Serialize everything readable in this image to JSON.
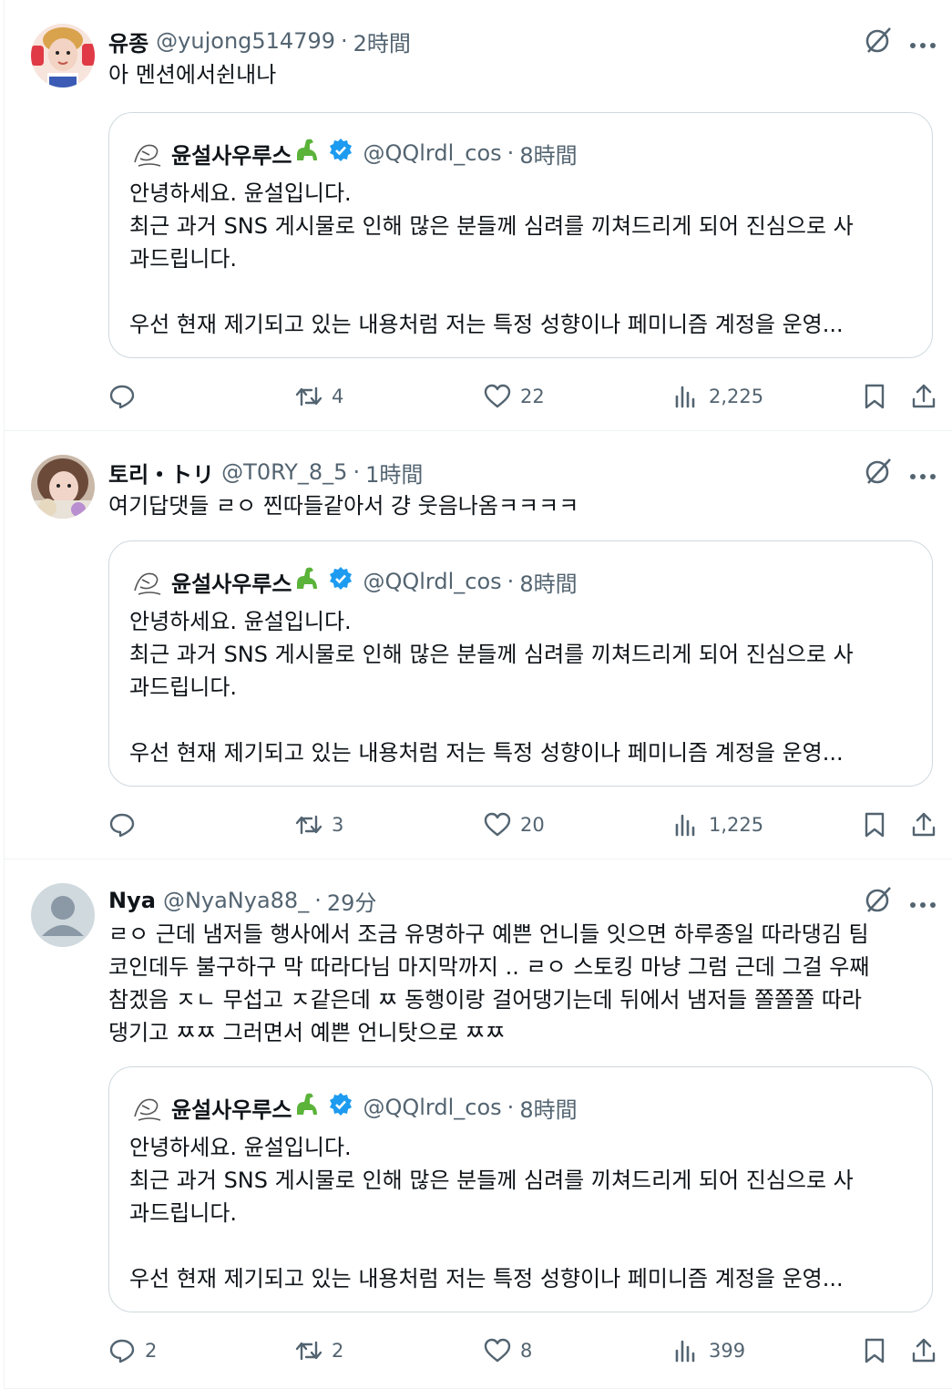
{
  "posts": [
    {
      "author": "유종",
      "handle": "@yujong514799",
      "separator": "·",
      "time": "2時間",
      "text": "아 멘션에서쉰내나",
      "avatar_icon": "profile-photo",
      "quote": {
        "author": "윤설사우루스",
        "handle": "@QQlrdl_cos",
        "separator": "·",
        "time": "8時間",
        "text": "안녕하세요. 윤설입니다.\n최근 과거 SNS 게시물로 인해 많은 분들께 심려를 끼쳐드리게 되어 진심으로 사\n과드립니다.\n\n우선 현재 제기되고 있는 내용처럼 저는 특정 성향이나 페미니즘 계정을 운영..."
      },
      "actions": {
        "replies": "",
        "reposts": "4",
        "likes": "22",
        "views": "2,225"
      }
    },
    {
      "author": "토리・トリ",
      "handle": "@T0RY_8_5",
      "separator": "·",
      "time": "1時間",
      "text": "여기답댓들 ㄹㅇ 찐따들같아서 걍 웃음나옴ㅋㅋㅋㅋ",
      "avatar_icon": "profile-photo",
      "quote": {
        "author": "윤설사우루스",
        "handle": "@QQlrdl_cos",
        "separator": "·",
        "time": "8時間",
        "text": "안녕하세요. 윤설입니다.\n최근 과거 SNS 게시물로 인해 많은 분들께 심려를 끼쳐드리게 되어 진심으로 사\n과드립니다.\n\n우선 현재 제기되고 있는 내용처럼 저는 특정 성향이나 페미니즘 계정을 운영..."
      },
      "actions": {
        "replies": "",
        "reposts": "3",
        "likes": "20",
        "views": "1,225"
      }
    },
    {
      "author": "Nya",
      "handle": "@NyaNya88_",
      "separator": "·",
      "time": "29分",
      "text": "ㄹㅇ 근데 냄저들 행사에서 조금 유명하구 예쁜 언니들 잇으면 하루종일 따라댕김 팀\n코인데두 불구하구 막 따라다님 마지막까지 .. ㄹㅇ 스토킹 마냥 그럼 근데 그걸 우째\n참겠음 ㅈㄴ 무섭고 ㅈ같은데 ㅉ 동행이랑 걸어댕기는데 뒤에서 냄저들 쫄쫄쫄 따라\n댕기고 ㅉㅉ 그러면서 예쁜 언니탓으로 ㅉㅉ",
      "avatar_icon": "default-avatar",
      "quote": {
        "author": "윤설사우루스",
        "handle": "@QQlrdl_cos",
        "separator": "·",
        "time": "8時間",
        "text": "안녕하세요. 윤설입니다.\n최근 과거 SNS 게시물로 인해 많은 분들께 심려를 끼쳐드리게 되어 진심으로 사\n과드립니다.\n\n우선 현재 제기되고 있는 내용처럼 저는 특정 성향이나 페미니즘 계정을 운영..."
      },
      "actions": {
        "replies": "2",
        "reposts": "2",
        "likes": "8",
        "views": "399"
      }
    }
  ],
  "icons": {
    "reply": "reply-icon",
    "repost": "repost-icon",
    "like": "heart-icon",
    "views": "views-icon",
    "bookmark": "bookmark-icon",
    "share": "share-icon",
    "grok": "grok-icon",
    "more": "more-icon",
    "verified": "verified-badge-icon",
    "dino": "dinosaur-emoji"
  },
  "colors": {
    "text": "#0f1419",
    "secondary": "#536471",
    "border": "#cfd9de",
    "divider": "#eff3f4",
    "verified": "#1d9bf0",
    "dino": "#5bb33a"
  }
}
